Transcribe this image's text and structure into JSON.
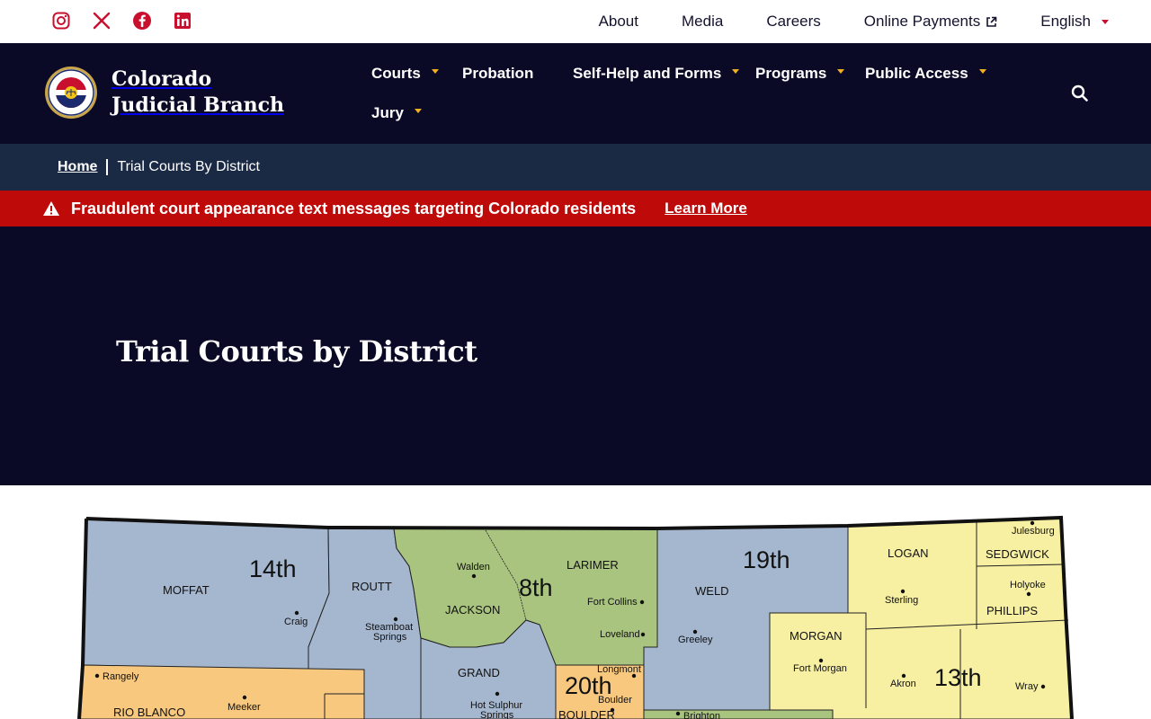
{
  "utility": {
    "social": [
      "instagram-icon",
      "x-icon",
      "facebook-icon",
      "linkedin-icon"
    ],
    "links": {
      "about": "About",
      "media": "Media",
      "careers": "Careers",
      "payments": "Online Payments",
      "language": "English"
    }
  },
  "header": {
    "brand_name": "Colorado Judicial Branch",
    "nav": {
      "courts": "Courts",
      "probation": "Probation",
      "self_help": "Self-Help and Forms",
      "programs": "Programs",
      "public_access": "Public Access",
      "jury": "Jury"
    }
  },
  "breadcrumb": {
    "home": "Home",
    "current": "Trial Courts By District"
  },
  "alert": {
    "text": "Fraudulent court appearance text messages targeting Colorado residents",
    "link": "Learn More"
  },
  "hero": {
    "title": "Trial Courts by District"
  },
  "map": {
    "districts": {
      "d14": "14th",
      "d8": "8th",
      "d19": "19th",
      "d13": "13th",
      "d20": "20th"
    },
    "counties": {
      "moffat": "MOFFAT",
      "routt": "ROUTT",
      "jackson": "JACKSON",
      "larimer": "LARIMER",
      "weld": "WELD",
      "logan": "LOGAN",
      "sedgwick": "SEDGWICK",
      "phillips": "PHILLIPS",
      "morgan": "MORGAN",
      "grand": "GRAND",
      "boulder": "BOULDER",
      "rio_blanco": "RIO BLANCO"
    },
    "towns": {
      "craig": "Craig",
      "steamboat": "Steamboat",
      "steamboat2": "Springs",
      "walden": "Walden",
      "fort_collins": "Fort Collins",
      "loveland": "Loveland",
      "greeley": "Greeley",
      "sterling": "Sterling",
      "julesburg": "Julesburg",
      "holyoke": "Holyoke",
      "fort_morgan": "Fort Morgan",
      "akron": "Akron",
      "wray": "Wray",
      "longmont": "Longmont",
      "boulder_town": "Boulder",
      "hot_sulphur": "Hot Sulphur",
      "hot_sulphur2": "Springs",
      "rangely": "Rangely",
      "meeker": "Meeker",
      "brighton": "Brighton"
    },
    "colors": {
      "blue": "#a5b6cf",
      "green": "#a9c47f",
      "yellow": "#f7f0a2",
      "orange": "#f7c87e"
    }
  }
}
